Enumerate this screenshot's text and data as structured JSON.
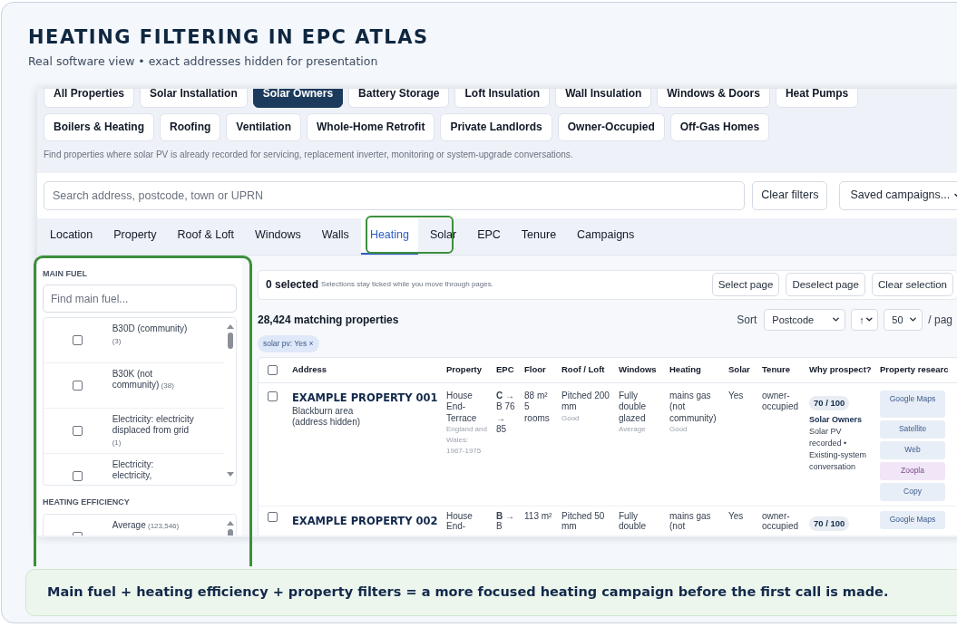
{
  "header": {
    "title": "HEATING FILTERING IN EPC ATLAS",
    "subtitle": "Real software view • exact addresses hidden for presentation"
  },
  "segments": [
    {
      "label": "All Properties",
      "selected": false
    },
    {
      "label": "Solar Installation",
      "selected": false
    },
    {
      "label": "Solar Owners",
      "selected": true
    },
    {
      "label": "Battery Storage",
      "selected": false
    },
    {
      "label": "Loft Insulation",
      "selected": false
    },
    {
      "label": "Wall Insulation",
      "selected": false
    },
    {
      "label": "Windows & Doors",
      "selected": false
    },
    {
      "label": "Heat Pumps",
      "selected": false
    },
    {
      "label": "Boilers & Heating",
      "selected": false
    },
    {
      "label": "Roofing",
      "selected": false
    },
    {
      "label": "Ventilation",
      "selected": false
    },
    {
      "label": "Whole-Home Retrofit",
      "selected": false
    },
    {
      "label": "Private Landlords",
      "selected": false
    },
    {
      "label": "Owner-Occupied",
      "selected": false
    },
    {
      "label": "Off-Gas Homes",
      "selected": false
    }
  ],
  "segment_hint": "Find properties where solar PV is already recorded for servicing, replacement inverter, monitoring or system-upgrade conversations.",
  "search": {
    "placeholder": "Search address, postcode, town or UPRN"
  },
  "clear_filters": "Clear filters",
  "saved_campaigns": "Saved campaigns...",
  "tabs": [
    {
      "label": "Location",
      "selected": false
    },
    {
      "label": "Property",
      "selected": false
    },
    {
      "label": "Roof & Loft",
      "selected": false
    },
    {
      "label": "Windows",
      "selected": false
    },
    {
      "label": "Walls",
      "selected": false
    },
    {
      "label": "Heating",
      "selected": true
    },
    {
      "label": "Solar",
      "selected": false
    },
    {
      "label": "EPC",
      "selected": false
    },
    {
      "label": "Tenure",
      "selected": false
    },
    {
      "label": "Campaigns",
      "selected": false
    }
  ],
  "sidebar": {
    "sections": [
      {
        "title": "MAIN FUEL",
        "placeholder": "Find main fuel...",
        "options": [
          {
            "label": "B30D (community)",
            "count": "(3)",
            "checked": false
          },
          {
            "label": "B30K (not community)",
            "count": "(38)",
            "checked": false
          },
          {
            "label": "Electricity: electricity displaced from grid",
            "count": "(1)",
            "checked": false
          },
          {
            "label": "Electricity: electricity,",
            "checked": false
          }
        ]
      },
      {
        "title": "HEATING EFFICIENCY",
        "options": [
          {
            "label": "Average",
            "count": "(123,546)",
            "checked": false
          }
        ]
      }
    ]
  },
  "selection": {
    "count": "0 selected",
    "hint": "Selections stay ticked while you move through pages.",
    "buttons": [
      "Select page",
      "Deselect page",
      "Clear selection"
    ]
  },
  "results": {
    "count": "28,424 matching properties",
    "sort_label": "Sort",
    "sort": "Postcode",
    "direction": "↑",
    "per_page": "50",
    "per_page_suffix": "/ pag"
  },
  "active_filters": [
    "solar pv: Yes ×"
  ],
  "table": {
    "select_all_checked": false,
    "columns": [
      "Address",
      "Property",
      "EPC",
      "Floor",
      "Roof / Loft",
      "Windows",
      "Heating",
      "Solar",
      "Tenure",
      "Why prospect?",
      "Property researc"
    ],
    "rows": [
      {
        "checked": false,
        "cells": [
          {
            "kind": "address",
            "name": "EXAMPLE PROPERTY 001",
            "lines": [
              "Blackburn area",
              "(address hidden)"
            ]
          },
          {
            "kind": "text",
            "main": "House End-Terrace",
            "sub": "England and Wales: 1967-1975"
          },
          {
            "kind": "text",
            "main": "**C** → B 76 → 85"
          },
          {
            "kind": "text",
            "main": "88 m² 5 rooms"
          },
          {
            "kind": "text",
            "main": "Pitched 200 mm",
            "sub": "Good"
          },
          {
            "kind": "text",
            "main": "Fully double glazed",
            "sub": "Average"
          },
          {
            "kind": "text",
            "main": "mains gas (not community)",
            "sub": "Good"
          },
          {
            "kind": "text",
            "main": "Yes"
          },
          {
            "kind": "text",
            "main": "owner-occupied"
          },
          {
            "kind": "why",
            "score": "70 / 100",
            "title": "Solar Owners",
            "text": "Solar PV recorded • Existing-system conversation"
          },
          {
            "kind": "research",
            "buttons": [
              {
                "label": "Google Maps",
                "highlighted": false
              },
              {
                "label": "Satellite",
                "highlighted": false
              },
              {
                "label": "Web",
                "highlighted": false
              },
              {
                "label": "Zoopla",
                "highlighted": true
              },
              {
                "label": "Copy",
                "highlighted": false
              }
            ]
          }
        ]
      },
      {
        "checked": false,
        "cells": [
          {
            "kind": "address",
            "name": "EXAMPLE PROPERTY 002"
          },
          {
            "kind": "text",
            "main": "House End-"
          },
          {
            "kind": "text",
            "main": "**B** → B"
          },
          {
            "kind": "text",
            "main": "113 m²"
          },
          {
            "kind": "text",
            "main": "Pitched 50 mm"
          },
          {
            "kind": "text",
            "main": "Fully double"
          },
          {
            "kind": "text",
            "main": "mains gas (not"
          },
          {
            "kind": "text",
            "main": "Yes"
          },
          {
            "kind": "text",
            "main": "owner-occupied"
          },
          {
            "kind": "why",
            "score": "70 / 100"
          },
          {
            "kind": "research",
            "buttons": [
              {
                "label": "Google Maps",
                "highlighted": false
              }
            ]
          }
        ]
      }
    ]
  },
  "caption": "Main fuel + heating efficiency + property filters = a more focused heating campaign before the first call is made."
}
